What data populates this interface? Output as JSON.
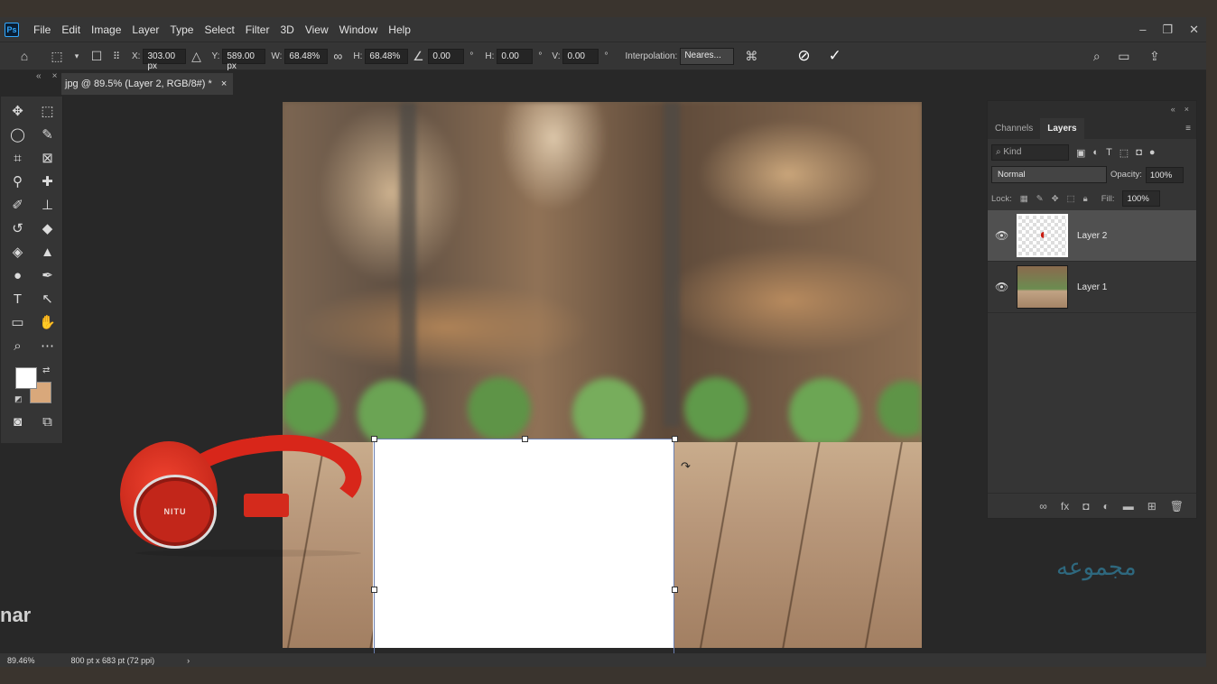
{
  "menubar": {
    "logo": "Ps",
    "items": [
      "File",
      "Edit",
      "Image",
      "Layer",
      "Type",
      "Select",
      "Filter",
      "3D",
      "View",
      "Window",
      "Help"
    ],
    "controls": [
      "–",
      "❐",
      "✕"
    ]
  },
  "options": {
    "x_label": "X:",
    "x_value": "303.00 px",
    "y_label": "Y:",
    "y_value": "589.00 px",
    "w_label": "W:",
    "w_value": "68.48%",
    "h_label": "H:",
    "h_value": "68.48%",
    "angle_value": "0.00",
    "hskew_label": "H:",
    "hskew_value": "0.00",
    "vskew_label": "V:",
    "vskew_value": "0.00",
    "degree_sign": "°",
    "interpolation_label": "Interpolation:",
    "interpolation_value": "Neares..."
  },
  "document": {
    "tab_title": "jpg @ 89.5% (Layer 2, RGB/8#) *",
    "close": "×"
  },
  "canvas": {
    "product_brand": "NITU"
  },
  "layers_panel": {
    "tabs": [
      "Channels",
      "Layers"
    ],
    "active_tab": "Layers",
    "kind_placeholder": "Kind",
    "blend_mode": "Normal",
    "opacity_label": "Opacity:",
    "opacity_value": "100%",
    "lock_label": "Lock:",
    "fill_label": "Fill:",
    "fill_value": "100%",
    "layers": [
      {
        "name": "Layer 2",
        "selected": true
      },
      {
        "name": "Layer 1",
        "selected": false
      }
    ]
  },
  "statusbar": {
    "zoom": "89.46%",
    "doc_size": "800 pt x 683 pt (72 ppi)",
    "arrow": "›"
  },
  "overlay": {
    "side_text": "nar",
    "watermark": "مجموعه"
  },
  "colors": {
    "foreground": "#ffffff",
    "background": "#d9a87b",
    "accent": "#31a8ff"
  }
}
